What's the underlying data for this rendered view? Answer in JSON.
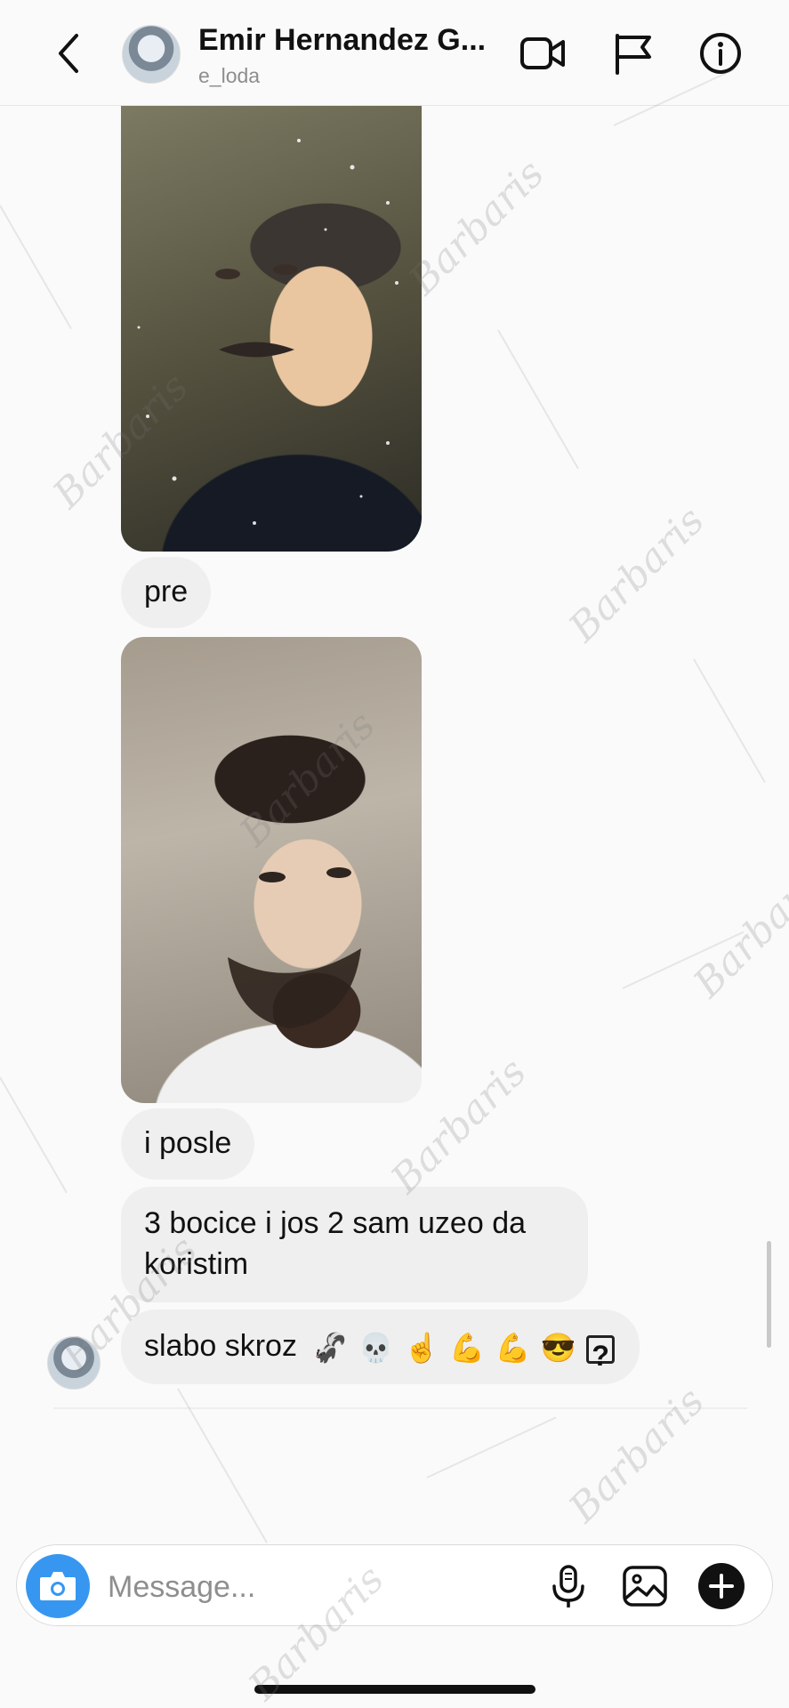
{
  "header": {
    "name": "Emir Hernandez G...",
    "username": "e_loda",
    "icons": [
      "back-chevron-icon",
      "video-camera-icon",
      "flag-icon",
      "info-icon"
    ]
  },
  "messages": [
    {
      "type": "photo"
    },
    {
      "type": "text",
      "text": "pre"
    },
    {
      "type": "photo"
    },
    {
      "type": "text",
      "text": "i posle"
    },
    {
      "type": "text",
      "text": "3 bocice i jos 2 sam uzeo da koristim"
    },
    {
      "type": "text",
      "text": "slabo skroz"
    }
  ],
  "emojis": [
    "🦨",
    "💀",
    "☝️",
    "💪",
    "💪",
    "😎",
    "?"
  ],
  "composer": {
    "placeholder": "Message...",
    "icons": [
      "camera-icon",
      "microphone-icon",
      "gallery-icon",
      "plus-icon"
    ]
  },
  "watermark": "Barbaris",
  "colors": {
    "accent": "#3797f0",
    "bubble": "#efefef",
    "background": "#fafafa"
  }
}
